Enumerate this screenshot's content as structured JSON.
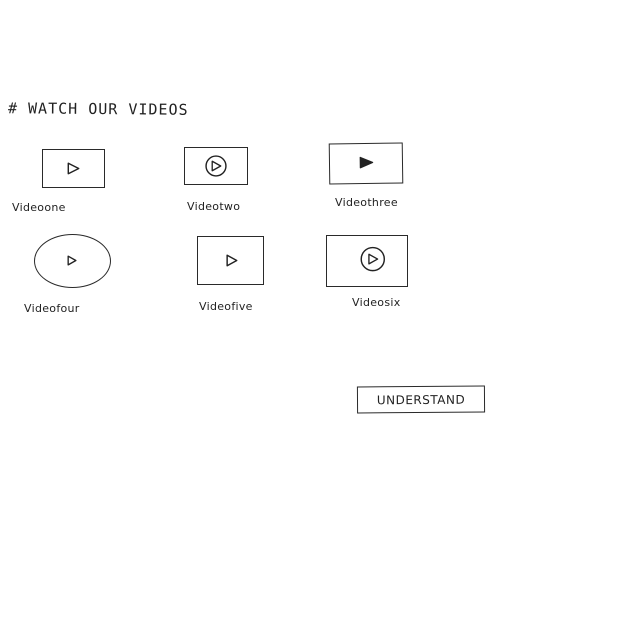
{
  "header": {
    "title": "# WATCH OUR VIDEOS"
  },
  "videos": [
    {
      "label": "Videoone",
      "thumb_shape": "rectangle",
      "icon": "play-outline-icon"
    },
    {
      "label": "Videotwo",
      "thumb_shape": "rectangle",
      "icon": "play-circle-icon"
    },
    {
      "label": "Videothree",
      "thumb_shape": "rectangle",
      "icon": "play-filled-icon"
    },
    {
      "label": "Videofour",
      "thumb_shape": "circle",
      "icon": "play-outline-icon"
    },
    {
      "label": "Videofive",
      "thumb_shape": "rectangle",
      "icon": "play-outline-icon"
    },
    {
      "label": "Videosix",
      "thumb_shape": "rectangle",
      "icon": "play-circle-icon"
    }
  ],
  "actions": {
    "understand_label": "UNDERSTAND"
  }
}
